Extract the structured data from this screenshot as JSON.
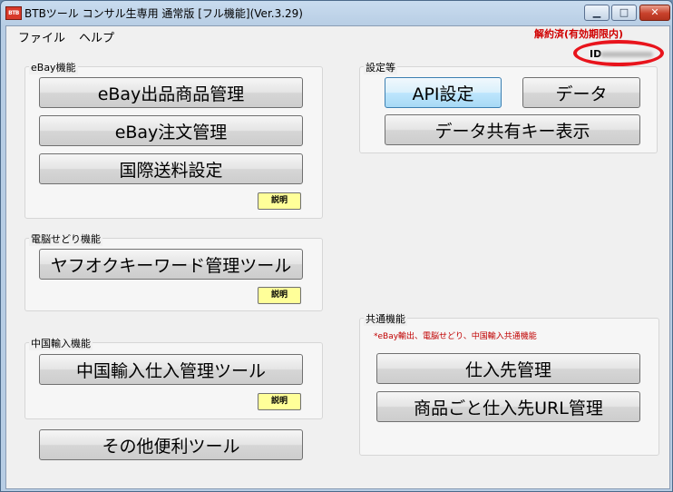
{
  "window": {
    "title": "BTBツール コンサル生専用 通常版 [フル機能](Ver.3.29)",
    "icon_text": "BTB",
    "min_glyph": "▁",
    "max_glyph": "□",
    "close_glyph": "✕"
  },
  "menu": {
    "file": "ファイル",
    "help": "ヘルプ"
  },
  "status": {
    "notice": "解約済(有効期限内)",
    "id_label": "ID"
  },
  "ebay": {
    "label": "eBay機能",
    "listing_button": "eBay出品商品管理",
    "order_button": "eBay注文管理",
    "shipping_button": "国際送料設定",
    "help_button": "説明"
  },
  "sedori": {
    "label": "電脳せどり機能",
    "keyword_button": "ヤフオクキーワード管理ツール",
    "help_button": "説明"
  },
  "china": {
    "label": "中国輸入機能",
    "purchase_button": "中国輸入仕入管理ツール",
    "help_button": "説明"
  },
  "other": {
    "tools_button": "その他便利ツール"
  },
  "settings": {
    "label": "設定等",
    "api_button": "API設定",
    "data_button": "データ",
    "sharekey_button": "データ共有キー表示"
  },
  "common": {
    "label": "共通機能",
    "note": "*eBay輸出、電脳せどり、中国輸入共通機能",
    "supplier_button": "仕入先管理",
    "supplier_url_button": "商品ごと仕入先URL管理"
  },
  "colors": {
    "notice_red": "#d00000",
    "help_yellow": "#ffff99",
    "close_red": "#c8412b"
  }
}
